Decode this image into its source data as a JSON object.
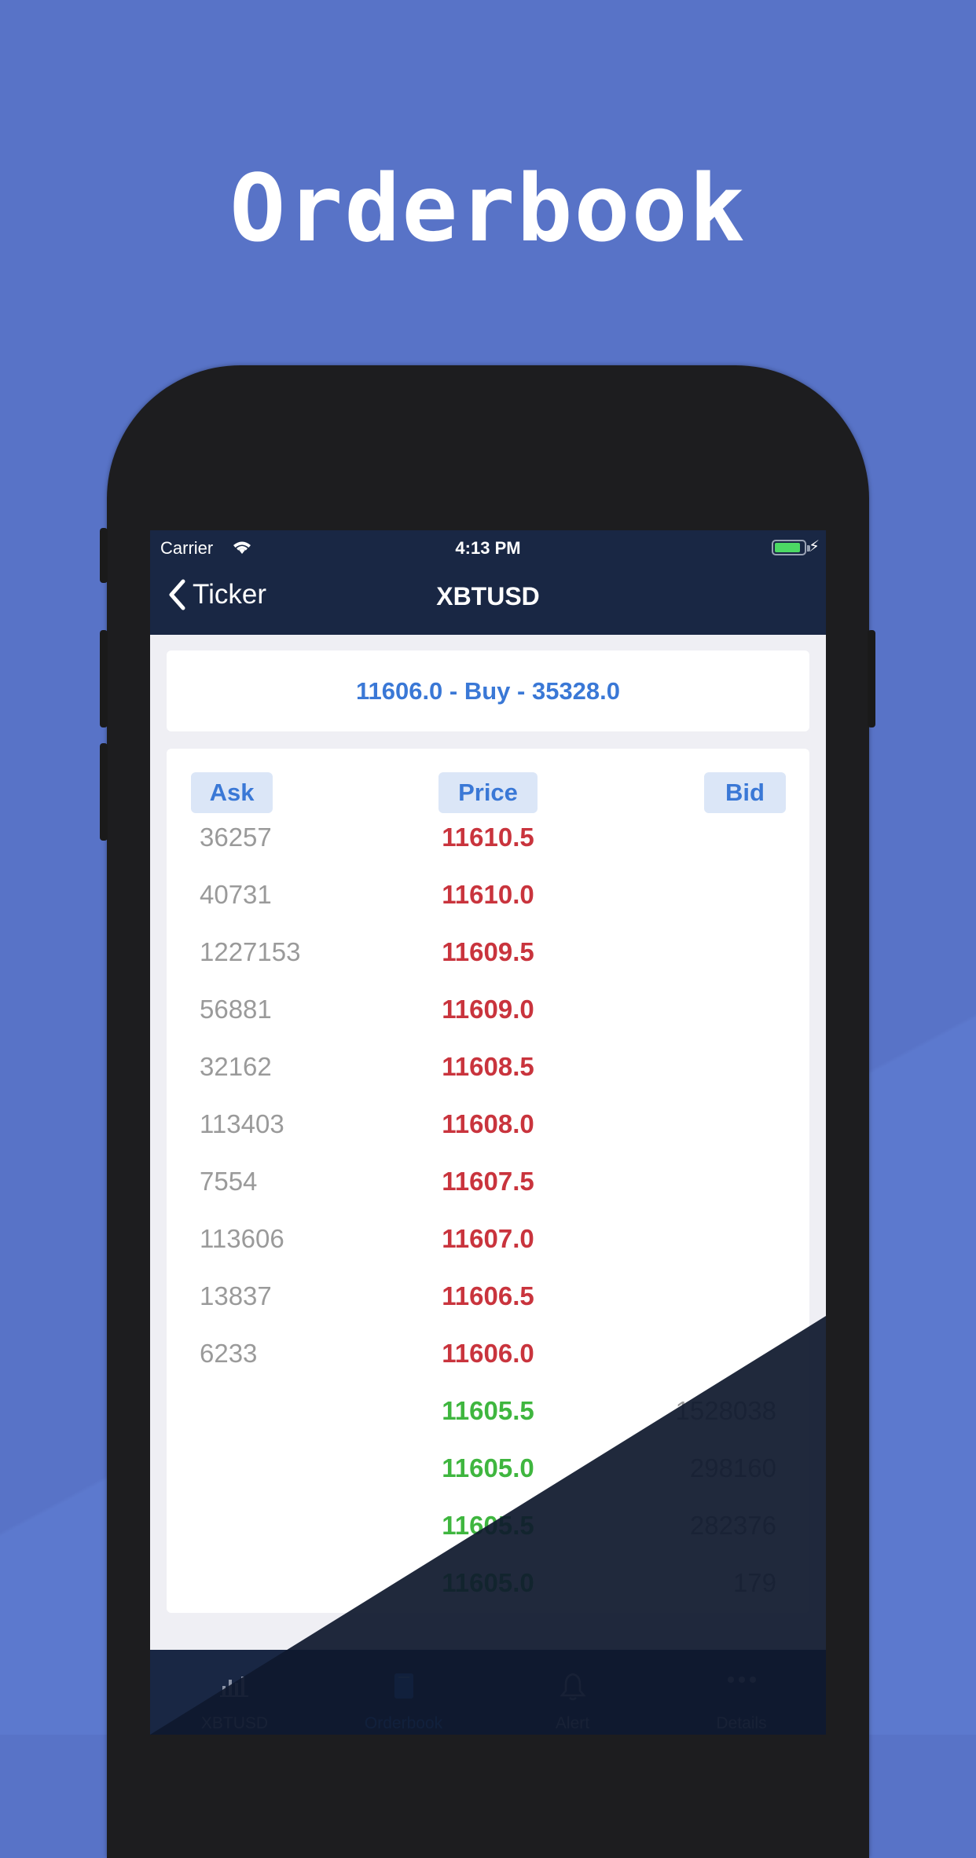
{
  "headline": "Orderbook",
  "status": {
    "carrier": "Carrier",
    "time": "4:13 PM"
  },
  "nav": {
    "back_label": "Ticker",
    "title": "XBTUSD"
  },
  "summary": "11606.0 - Buy - 35328.0",
  "columns": {
    "ask": "Ask",
    "price": "Price",
    "bid": "Bid"
  },
  "rows": [
    {
      "ask": "36257",
      "price": "11610.5",
      "bid": "",
      "side": "ask"
    },
    {
      "ask": "40731",
      "price": "11610.0",
      "bid": "",
      "side": "ask"
    },
    {
      "ask": "1227153",
      "price": "11609.5",
      "bid": "",
      "side": "ask"
    },
    {
      "ask": "56881",
      "price": "11609.0",
      "bid": "",
      "side": "ask"
    },
    {
      "ask": "32162",
      "price": "11608.5",
      "bid": "",
      "side": "ask"
    },
    {
      "ask": "113403",
      "price": "11608.0",
      "bid": "",
      "side": "ask"
    },
    {
      "ask": "7554",
      "price": "11607.5",
      "bid": "",
      "side": "ask"
    },
    {
      "ask": "113606",
      "price": "11607.0",
      "bid": "",
      "side": "ask"
    },
    {
      "ask": "13837",
      "price": "11606.5",
      "bid": "",
      "side": "ask"
    },
    {
      "ask": "6233",
      "price": "11606.0",
      "bid": "",
      "side": "ask"
    },
    {
      "ask": "",
      "price": "11605.5",
      "bid": "1528038",
      "side": "bid"
    },
    {
      "ask": "",
      "price": "11605.0",
      "bid": "298160",
      "side": "bid"
    },
    {
      "ask": "",
      "price": "11605.5",
      "bid": "282376",
      "side": "bid"
    },
    {
      "ask": "",
      "price": "11605.0",
      "bid": "179",
      "side": "bid"
    }
  ],
  "tabs": [
    {
      "label": "XBTUSD",
      "icon": "bar-chart-icon",
      "active": false
    },
    {
      "label": "Orderbook",
      "icon": "book-icon",
      "active": true
    },
    {
      "label": "Alert",
      "icon": "bell-icon",
      "active": false
    },
    {
      "label": "Details",
      "icon": "more-dots-icon",
      "active": false
    }
  ],
  "colors": {
    "background": "#5873c7",
    "nav": "#192744",
    "ask_price": "#c9343d",
    "bid_price": "#3fb63f",
    "accent": "#3a78d6",
    "tab_active": "#2f86ff"
  }
}
